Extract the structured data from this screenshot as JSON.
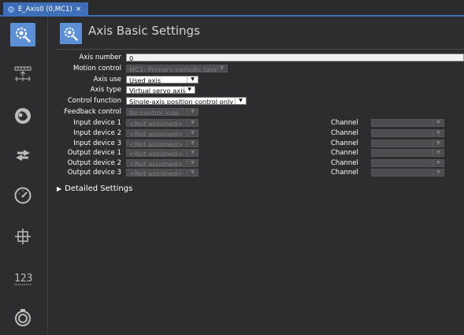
{
  "tab": {
    "label": "E_Axis0 (0,MC1)",
    "close": "×"
  },
  "header": {
    "title": "Axis Basic Settings"
  },
  "form": {
    "axis_number": {
      "label": "Axis number",
      "value": "0"
    },
    "motion_control": {
      "label": "Motion control",
      "value": "MC1: Primary periodic task"
    },
    "axis_use": {
      "label": "Axis use",
      "value": "Used axis"
    },
    "axis_type": {
      "label": "Axis type",
      "value": "Virtual servo axis"
    },
    "control_function": {
      "label": "Control function",
      "value": "Single-axis position control only"
    },
    "feedback_control": {
      "label": "Feedback control",
      "value": "No control loop"
    },
    "input_device_1": {
      "label": "Input device 1",
      "value": "<Not assigned>"
    },
    "input_device_2": {
      "label": "Input device 2",
      "value": "<Not assigned>"
    },
    "input_device_3": {
      "label": "Input device 3",
      "value": "<Not assigned>"
    },
    "output_device_1": {
      "label": "Output device 1",
      "value": "<Not assigned>"
    },
    "output_device_2": {
      "label": "Output device 2",
      "value": "<Not assigned>"
    },
    "output_device_3": {
      "label": "Output device 3",
      "value": "<Not assigned>"
    },
    "channel_label": "Channel"
  },
  "detailed_settings": {
    "label": "Detailed Settings"
  },
  "sidebar": {
    "items": [
      {
        "name": "axis-basic-settings",
        "icon": "gear-search-icon",
        "selected": true
      },
      {
        "name": "unit-conversion",
        "icon": "ruler-arrows-icon"
      },
      {
        "name": "operation-settings",
        "icon": "motor-icon"
      },
      {
        "name": "other-operation-settings",
        "icon": "arrows-icon"
      },
      {
        "name": "limit-settings",
        "icon": "gauge-icon"
      },
      {
        "name": "position-count-settings",
        "icon": "crosshair-icon"
      },
      {
        "name": "servo-drive-settings",
        "icon": "number-123-icon"
      },
      {
        "name": "homing-settings",
        "icon": "camera-icon"
      }
    ]
  },
  "colors": {
    "accent": "#3f6eb8",
    "selected": "#5b8fd6",
    "background": "#2d2d30"
  }
}
